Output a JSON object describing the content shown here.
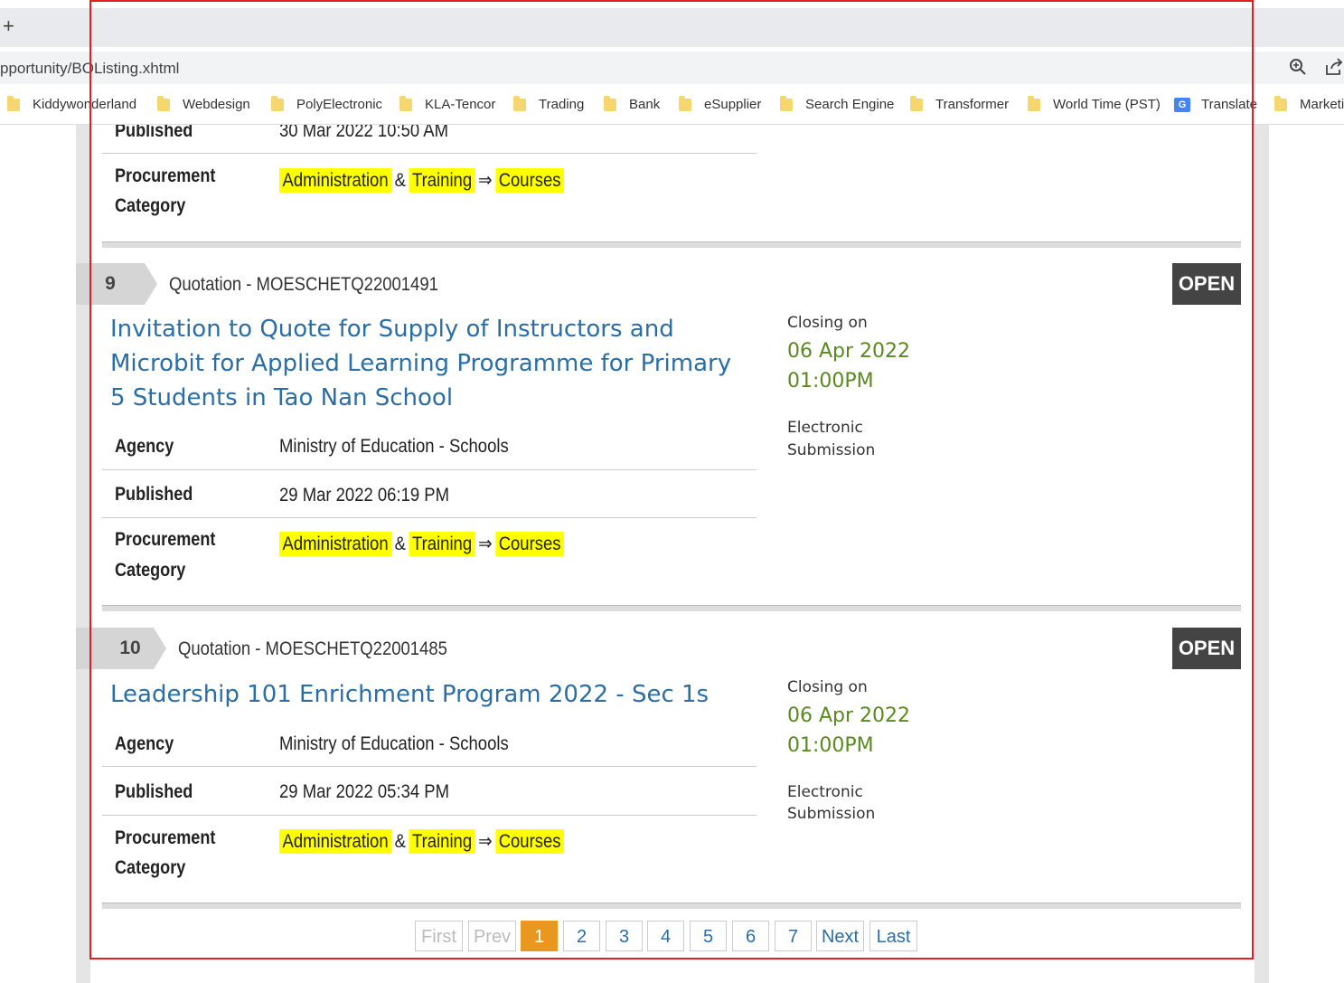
{
  "browser": {
    "new_tab_symbol": "+",
    "url": "pportunity/BOListing.xhtml",
    "bookmarks": [
      "Kiddywonderland",
      "Webdesign",
      "PolyElectronic",
      "KLA-Tencor",
      "Trading",
      "Bank",
      "eSupplier",
      "Search Engine",
      "Transformer",
      "World Time (PST)",
      "Translate",
      "Marketi"
    ]
  },
  "top_partial": {
    "published_label": "Published",
    "published_value": "30 Mar 2022 10:50 AM",
    "category_label_1": "Procurement",
    "category_label_2": "Category",
    "category": [
      "Administration",
      "&",
      "Training",
      "⇒",
      "Courses"
    ]
  },
  "listings": [
    {
      "number": "9",
      "ref": "Quotation - MOESCHETQ22001491",
      "status": "OPEN",
      "title": "Invitation to Quote for Supply of Instructors and Microbit for Applied Learning Programme for Primary 5 Students in Tao Nan School",
      "closing_label": "Closing on",
      "closing_date": "06 Apr 2022",
      "closing_time": "01:00PM",
      "submission_1": "Electronic",
      "submission_2": "Submission",
      "agency_label": "Agency",
      "agency": "Ministry of Education - Schools",
      "published_label": "Published",
      "published": "29 Mar 2022 06:19 PM",
      "category_label_1": "Procurement",
      "category_label_2": "Category",
      "category": [
        "Administration",
        "&",
        "Training",
        "⇒",
        "Courses"
      ]
    },
    {
      "number": "10",
      "ref": "Quotation - MOESCHETQ22001485",
      "status": "OPEN",
      "title": "Leadership 101 Enrichment Program 2022 - Sec 1s",
      "closing_label": "Closing on",
      "closing_date": "06 Apr 2022",
      "closing_time": "01:00PM",
      "submission_1": "Electronic",
      "submission_2": "Submission",
      "agency_label": "Agency",
      "agency": "Ministry of Education - Schools",
      "published_label": "Published",
      "published": "29 Mar 2022 05:34 PM",
      "category_label_1": "Procurement",
      "category_label_2": "Category",
      "category": [
        "Administration",
        "&",
        "Training",
        "⇒",
        "Courses"
      ]
    }
  ],
  "pagination": {
    "first": "First",
    "prev": "Prev",
    "pages": [
      "1",
      "2",
      "3",
      "4",
      "5",
      "6",
      "7"
    ],
    "current": "1",
    "next": "Next",
    "last": "Last"
  },
  "colors": {
    "title_link": "#2a6ea8",
    "closing_value": "#5a8a1f",
    "highlight": "#ffff00",
    "pager_active": "#e8981e",
    "annotation_frame": "#e02020"
  }
}
